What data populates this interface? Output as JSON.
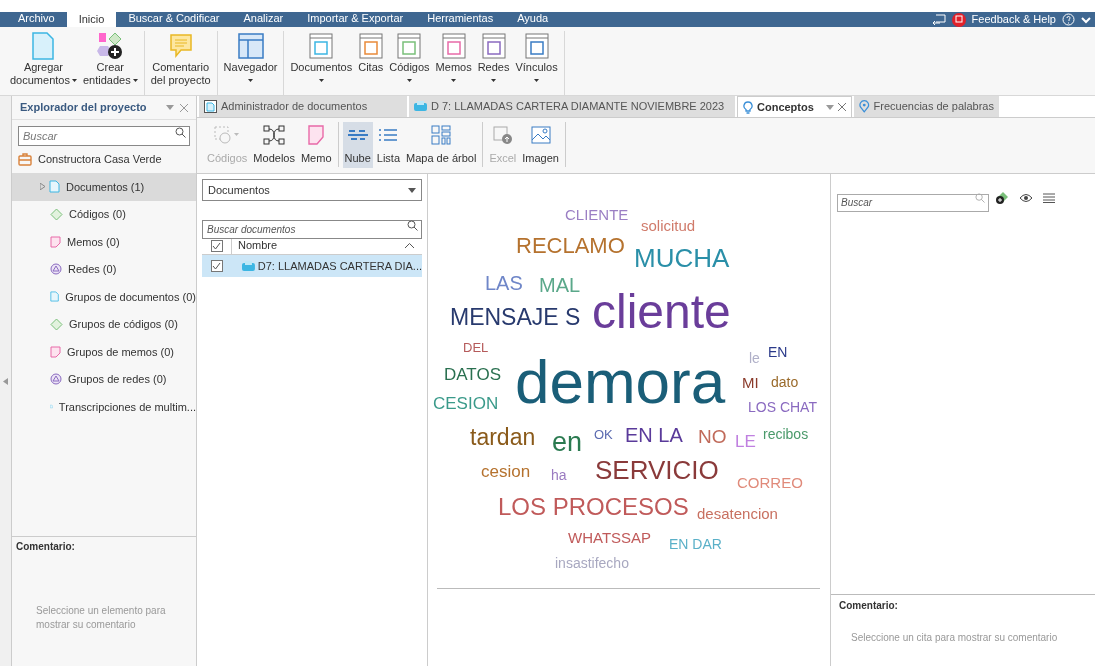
{
  "menu_tabs": [
    {
      "label": "Archivo",
      "selected": false
    },
    {
      "label": "Inicio",
      "selected": true
    },
    {
      "label": "Buscar & Codificar",
      "selected": false
    },
    {
      "label": "Analizar",
      "selected": false
    },
    {
      "label": "Importar & Exportar",
      "selected": false
    },
    {
      "label": "Herramientas",
      "selected": false
    },
    {
      "label": "Ayuda",
      "selected": false
    }
  ],
  "feedback": "Feedback & Help",
  "ribbon": [
    [
      {
        "lines": [
          "Agregar",
          "documentos"
        ],
        "dropdown": true
      },
      {
        "lines": [
          "Crear",
          "entidades"
        ],
        "dropdown": true
      }
    ],
    [
      {
        "lines": [
          "Comentario",
          "del proyecto"
        ],
        "dropdown": false
      }
    ],
    [
      {
        "lines": [
          "Navegador"
        ],
        "dropdown": true
      }
    ],
    [
      {
        "lines": [
          "Documentos"
        ],
        "dropdown": true
      },
      {
        "lines": [
          "Citas"
        ],
        "dropdown": false
      },
      {
        "lines": [
          "Códigos"
        ],
        "dropdown": true
      },
      {
        "lines": [
          "Memos"
        ],
        "dropdown": true
      },
      {
        "lines": [
          "Redes"
        ],
        "dropdown": true
      },
      {
        "lines": [
          "Vínculos"
        ],
        "dropdown": true
      }
    ]
  ],
  "explorer": {
    "title": "Explorador del proyecto",
    "search_placeholder": "Buscar",
    "project": "Constructora Casa Verde",
    "items": [
      {
        "label": "Documentos (1)",
        "selected": true
      },
      {
        "label": "Códigos (0)",
        "selected": false
      },
      {
        "label": "Memos (0)",
        "selected": false
      },
      {
        "label": "Redes (0)",
        "selected": false
      },
      {
        "label": "Grupos de documentos (0)",
        "selected": false
      },
      {
        "label": "Grupos de códigos (0)",
        "selected": false
      },
      {
        "label": "Grupos de memos (0)",
        "selected": false
      },
      {
        "label": "Grupos de redes (0)",
        "selected": false
      },
      {
        "label": "Transcripciones de multim...",
        "selected": false
      }
    ],
    "comment_title": "Comentario:",
    "comment_hint": "Seleccione un elemento para mostrar su comentario"
  },
  "doc_tabs": [
    {
      "label": "Administrador de documentos",
      "selected": false
    },
    {
      "label": "D 7: LLAMADAS CARTERA DIAMANTE NOVIEMBRE 2023",
      "selected": false
    },
    {
      "label": "Conceptos",
      "selected": true
    },
    {
      "label": "Frecuencias de palabras",
      "selected": false
    }
  ],
  "toolbar": [
    [
      {
        "label": "Códigos",
        "disabled": true,
        "selected": false
      },
      {
        "label": "Modelos",
        "disabled": false,
        "selected": false
      },
      {
        "label": "Memo",
        "disabled": false,
        "selected": false
      }
    ],
    [
      {
        "label": "Nube",
        "disabled": false,
        "selected": true
      },
      {
        "label": "Lista",
        "disabled": false,
        "selected": false
      },
      {
        "label": "Mapa de árbol",
        "disabled": false,
        "selected": false
      }
    ],
    [
      {
        "label": "Excel",
        "disabled": true,
        "selected": false
      },
      {
        "label": "Imagen",
        "disabled": false,
        "selected": false
      }
    ]
  ],
  "documents": {
    "dropdown": "Documentos",
    "search_placeholder": "Buscar documentos",
    "column": "Nombre",
    "header_checked": true,
    "rows": [
      {
        "label": "D7: LLAMADAS CARTERA DIA...",
        "checked": true,
        "selected": true
      }
    ]
  },
  "cloud": {
    "words": [
      {
        "text": "CLIENTE",
        "color": "#9b7fc4"
      },
      {
        "text": "solicitud",
        "color": "#d07a6a"
      },
      {
        "text": "RECLAMO",
        "color": "#b5722e"
      },
      {
        "text": "MUCHA",
        "color": "#2a8fa8"
      },
      {
        "text": "LAS",
        "color": "#6f86c8"
      },
      {
        "text": "MAL",
        "color": "#5aa88a"
      },
      {
        "text": "MENSAJE S",
        "color": "#283a6e"
      },
      {
        "text": "cliente",
        "color": "#6a3d9a"
      },
      {
        "text": "DEL",
        "color": "#b55a5a"
      },
      {
        "text": "le",
        "color": "#b0b0c8"
      },
      {
        "text": "EN",
        "color": "#2b3a8a"
      },
      {
        "text": "DATOS",
        "color": "#2a7050"
      },
      {
        "text": "demora",
        "color": "#1a5e78"
      },
      {
        "text": "MI",
        "color": "#8a3a2a"
      },
      {
        "text": "dato",
        "color": "#9a6a2a"
      },
      {
        "text": "CESION",
        "color": "#3a9a8a"
      },
      {
        "text": "LOS CHAT",
        "color": "#8a6ac0"
      },
      {
        "text": "tardan",
        "color": "#8a5a1a"
      },
      {
        "text": "en",
        "color": "#2a7a50"
      },
      {
        "text": "OK",
        "color": "#5a6ab0"
      },
      {
        "text": "EN LA",
        "color": "#5a3a9a"
      },
      {
        "text": "NO",
        "color": "#c06a5a"
      },
      {
        "text": "LE",
        "color": "#c080e0"
      },
      {
        "text": "recibos",
        "color": "#4a9a6a"
      },
      {
        "text": "cesion",
        "color": "#b5722e"
      },
      {
        "text": "ha",
        "color": "#9a7ac0"
      },
      {
        "text": "SERVICIO",
        "color": "#8a3a3a"
      },
      {
        "text": "CORREO",
        "color": "#e08a7a"
      },
      {
        "text": "LOS PROCESOS",
        "color": "#c05a5a"
      },
      {
        "text": "desatencion",
        "color": "#c87060"
      },
      {
        "text": "WHATSSAP",
        "color": "#c05a5a"
      },
      {
        "text": "EN DAR",
        "color": "#5ab0c8"
      },
      {
        "text": "insastifecho",
        "color": "#a8a8c0"
      }
    ]
  },
  "right_panel": {
    "search_placeholder": "Buscar",
    "comment_title": "Comentario:",
    "comment_hint": "Seleccione un cita para mostrar su comentario"
  }
}
